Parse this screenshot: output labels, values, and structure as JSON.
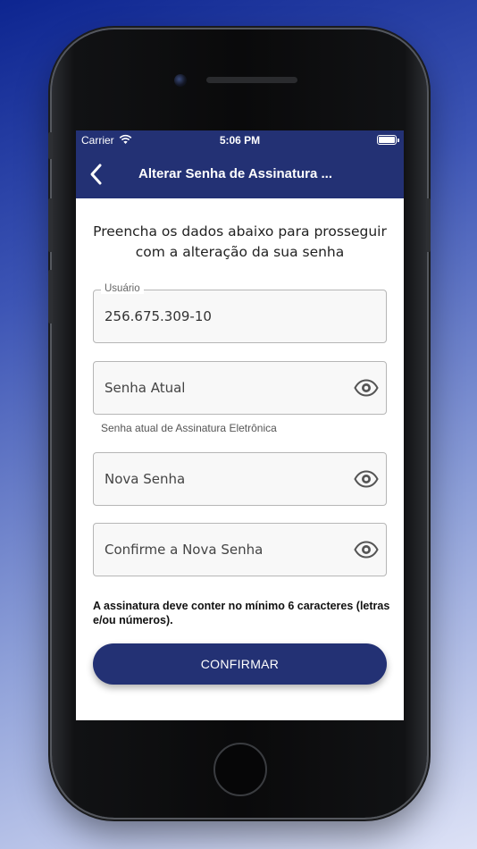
{
  "status_bar": {
    "carrier": "Carrier",
    "time": "5:06 PM"
  },
  "header": {
    "title": "Alterar Senha de Assinatura ...",
    "back_icon": "chevron-left-icon"
  },
  "instructions": "Preencha os dados abaixo para prosseguir com a alteração da sua senha",
  "form": {
    "usuario": {
      "label": "Usuário",
      "value": "256.675.309-10"
    },
    "senha_atual": {
      "placeholder": "Senha Atual",
      "helper": "Senha atual de Assinatura Eletrônica"
    },
    "nova_senha": {
      "placeholder": "Nova Senha"
    },
    "confirme_senha": {
      "placeholder": "Confirme a Nova Senha"
    },
    "eye_icon": "eye-icon"
  },
  "note": "A assinatura deve conter no mínimo 6 caracteres (letras e/ou números).",
  "confirm_label": "CONFIRMAR",
  "colors": {
    "primary": "#233174",
    "background_top": "#0d2590",
    "background_bottom": "#dde2f6"
  }
}
